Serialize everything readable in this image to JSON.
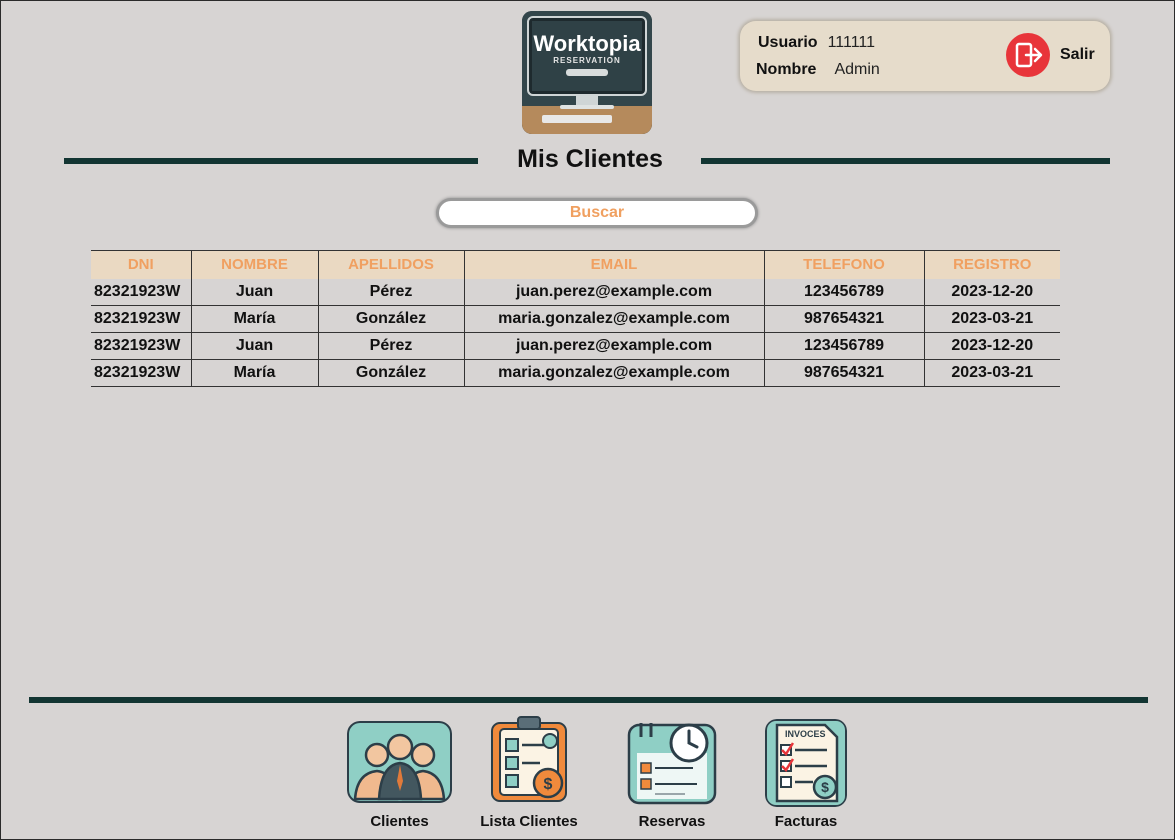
{
  "header": {
    "logo": {
      "name": "Worktopia",
      "subtitle": "RESERVATION"
    },
    "user": {
      "usuario_label": "Usuario",
      "usuario_value": "111111",
      "nombre_label": "Nombre",
      "nombre_value": "Admin"
    },
    "logout_label": "Salir"
  },
  "page": {
    "title": "Mis Clientes"
  },
  "search": {
    "label": "Buscar"
  },
  "table": {
    "columns": [
      "DNI",
      "NOMBRE",
      "APELLIDOS",
      "EMAIL",
      "TELEFONO",
      "REGISTRO"
    ],
    "rows": [
      [
        "82321923W",
        "Juan",
        "Pérez",
        "juan.perez@example.com",
        "123456789",
        "2023-12-20"
      ],
      [
        "82321923W",
        "María",
        "González",
        "maria.gonzalez@example.com",
        "987654321",
        "2023-03-21"
      ],
      [
        "82321923W",
        "Juan",
        "Pérez",
        "juan.perez@example.com",
        "123456789",
        "2023-12-20"
      ],
      [
        "82321923W",
        "María",
        "González",
        "maria.gonzalez@example.com",
        "987654321",
        "2023-03-21"
      ]
    ]
  },
  "nav": [
    {
      "label": "Clientes",
      "icon": "clients-group-icon"
    },
    {
      "label": "Lista Clientes",
      "icon": "client-list-clipboard-icon"
    },
    {
      "label": "Reservas",
      "icon": "reservations-clock-icon"
    },
    {
      "label": "Facturas",
      "icon": "invoices-document-icon"
    }
  ],
  "colors": {
    "background": "#d7d4d3",
    "rule": "#123532",
    "accent": "#f0a061",
    "logout": "#e8353a"
  }
}
